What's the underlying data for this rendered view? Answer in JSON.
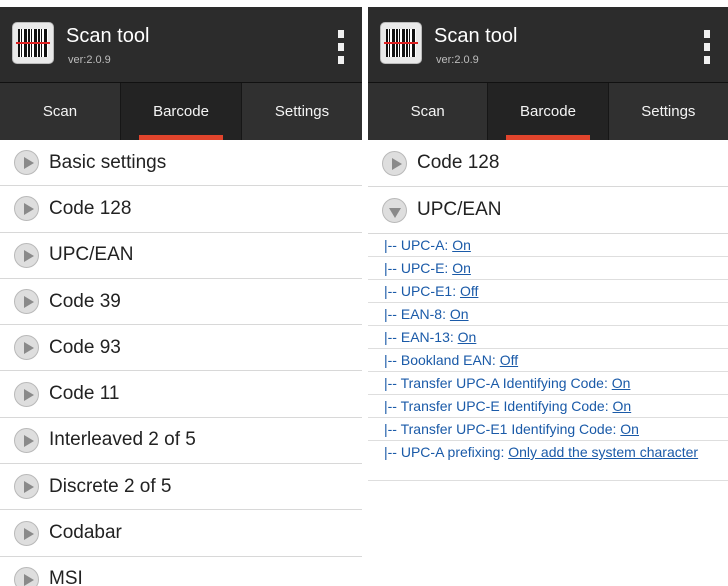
{
  "app": {
    "title": "Scan tool",
    "version": "ver:2.0.9"
  },
  "tabs": [
    "Scan",
    "Barcode",
    "Settings"
  ],
  "active_tab": "Barcode",
  "left_list": [
    "Basic settings",
    "Code 128",
    "UPC/EAN",
    "Code 39",
    "Code 93",
    "Code 11",
    "Interleaved 2 of 5",
    "Discrete 2 of 5",
    "Codabar",
    "MSI"
  ],
  "right_sections": {
    "collapsed": "Code 128",
    "expanded": "UPC/EAN"
  },
  "upc_ean_settings": [
    {
      "label": "|-- UPC-A: ",
      "value": "On"
    },
    {
      "label": "|-- UPC-E: ",
      "value": "On"
    },
    {
      "label": "|-- UPC-E1: ",
      "value": "Off"
    },
    {
      "label": "|-- EAN-8: ",
      "value": "On"
    },
    {
      "label": "|-- EAN-13: ",
      "value": "On"
    },
    {
      "label": "|-- Bookland EAN: ",
      "value": "Off"
    },
    {
      "label": "|-- Transfer UPC-A Identifying Code: ",
      "value": "On"
    },
    {
      "label": "|-- Transfer UPC-E Identifying Code: ",
      "value": "On"
    },
    {
      "label": "|-- Transfer UPC-E1 Identifying Code: ",
      "value": "On"
    },
    {
      "label": "|-- UPC-A prefixing: ",
      "value": "Only add the system character"
    }
  ],
  "colors": {
    "app_bar": "#2c2c2c",
    "tab_indicator": "#e1442c",
    "link_blue": "#1a5aa8"
  },
  "icons": {
    "app": "barcode-scanner-icon",
    "menu": "overflow-menu-icon",
    "row_collapsed": "play-circle-icon",
    "row_expanded": "expand-circle-icon"
  }
}
